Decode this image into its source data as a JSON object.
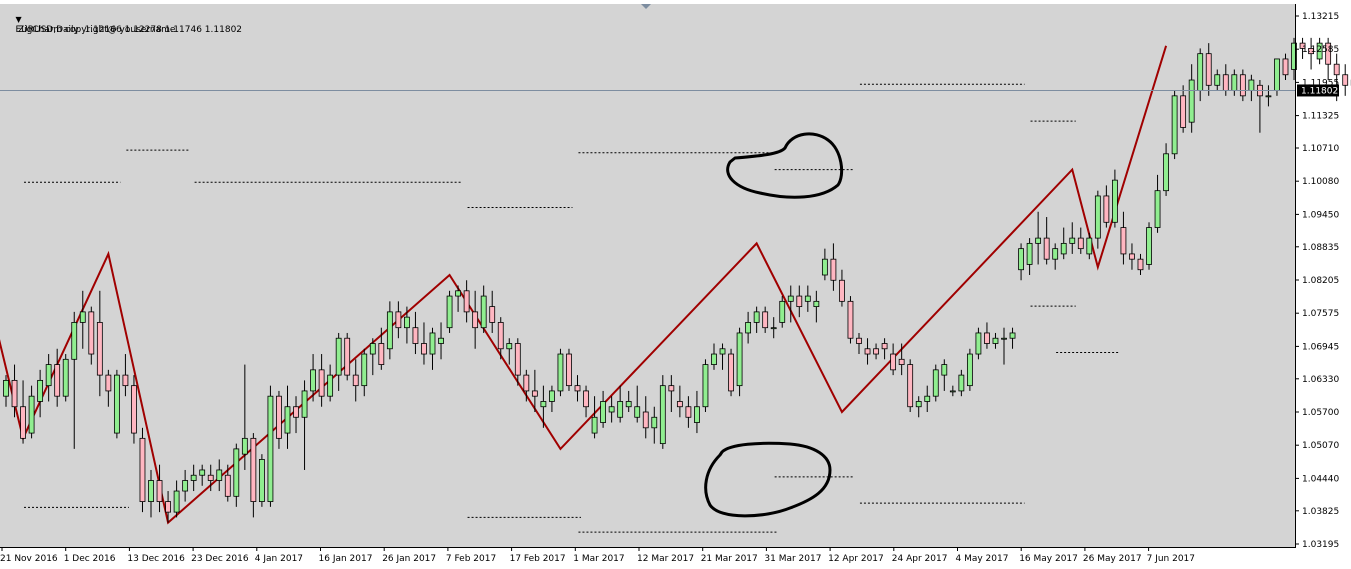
{
  "header": {
    "symbol_line": "EURUSD,Daily  1.12166 1.12278 1.11746 1.11802",
    "indicator_name": "ZigCharm copyright@ yousername"
  },
  "colors": {
    "background": "#d4d4d4",
    "bull": "#90ee90",
    "bear": "#ffb6c1",
    "wick": "#000000",
    "zigzag": "#a00000",
    "level_line": "#000000",
    "price_line": "#7d8da0",
    "price_tag": "#000000"
  },
  "price_axis": {
    "ticks": [
      "1.13215",
      "1.12585",
      "1.11955",
      "1.11325",
      "1.10710",
      "1.10080",
      "1.09450",
      "1.08835",
      "1.08205",
      "1.07575",
      "1.06945",
      "1.06330",
      "1.05700",
      "1.05070",
      "1.04440",
      "1.03825",
      "1.03195"
    ],
    "current_price": "1.11802"
  },
  "time_axis": {
    "labels": [
      "21 Nov 2016",
      "1 Dec 2016",
      "13 Dec 2016",
      "23 Dec 2016",
      "4 Jan 2017",
      "16 Jan 2017",
      "26 Jan 2017",
      "7 Feb 2017",
      "17 Feb 2017",
      "1 Mar 2017",
      "12 Mar 2017",
      "21 Mar 2017",
      "31 Mar 2017",
      "12 Apr 2017",
      "24 Apr 2017",
      "4 May 2017",
      "16 May 2017",
      "26 May 2017",
      "7 Jun 2017"
    ]
  },
  "chart_data": {
    "type": "candlestick",
    "symbol": "EURUSD",
    "timeframe": "Daily",
    "ylim": [
      1.03195,
      1.13215
    ],
    "candles": [
      {
        "o": 1.06,
        "h": 1.064,
        "l": 1.058,
        "c": 1.063
      },
      {
        "o": 1.063,
        "h": 1.066,
        "l": 1.056,
        "c": 1.058
      },
      {
        "o": 1.058,
        "h": 1.063,
        "l": 1.051,
        "c": 1.052
      },
      {
        "o": 1.053,
        "h": 1.062,
        "l": 1.052,
        "c": 1.06
      },
      {
        "o": 1.059,
        "h": 1.065,
        "l": 1.056,
        "c": 1.063
      },
      {
        "o": 1.062,
        "h": 1.068,
        "l": 1.059,
        "c": 1.066
      },
      {
        "o": 1.066,
        "h": 1.069,
        "l": 1.058,
        "c": 1.06
      },
      {
        "o": 1.06,
        "h": 1.068,
        "l": 1.059,
        "c": 1.067
      },
      {
        "o": 1.067,
        "h": 1.076,
        "l": 1.05,
        "c": 1.074
      },
      {
        "o": 1.074,
        "h": 1.08,
        "l": 1.069,
        "c": 1.076
      },
      {
        "o": 1.076,
        "h": 1.077,
        "l": 1.066,
        "c": 1.068
      },
      {
        "o": 1.074,
        "h": 1.08,
        "l": 1.06,
        "c": 1.064
      },
      {
        "o": 1.064,
        "h": 1.065,
        "l": 1.058,
        "c": 1.061
      },
      {
        "o": 1.053,
        "h": 1.065,
        "l": 1.052,
        "c": 1.064
      },
      {
        "o": 1.064,
        "h": 1.068,
        "l": 1.06,
        "c": 1.062
      },
      {
        "o": 1.062,
        "h": 1.064,
        "l": 1.051,
        "c": 1.053
      },
      {
        "o": 1.052,
        "h": 1.054,
        "l": 1.038,
        "c": 1.04
      },
      {
        "o": 1.04,
        "h": 1.046,
        "l": 1.037,
        "c": 1.044
      },
      {
        "o": 1.044,
        "h": 1.047,
        "l": 1.038,
        "c": 1.04
      },
      {
        "o": 1.04,
        "h": 1.042,
        "l": 1.036,
        "c": 1.038
      },
      {
        "o": 1.038,
        "h": 1.044,
        "l": 1.037,
        "c": 1.042
      },
      {
        "o": 1.042,
        "h": 1.046,
        "l": 1.04,
        "c": 1.044
      },
      {
        "o": 1.044,
        "h": 1.047,
        "l": 1.042,
        "c": 1.045
      },
      {
        "o": 1.045,
        "h": 1.047,
        "l": 1.043,
        "c": 1.046
      },
      {
        "o": 1.045,
        "h": 1.047,
        "l": 1.042,
        "c": 1.044
      },
      {
        "o": 1.044,
        "h": 1.048,
        "l": 1.042,
        "c": 1.046
      },
      {
        "o": 1.045,
        "h": 1.047,
        "l": 1.04,
        "c": 1.041
      },
      {
        "o": 1.041,
        "h": 1.051,
        "l": 1.039,
        "c": 1.05
      },
      {
        "o": 1.049,
        "h": 1.066,
        "l": 1.046,
        "c": 1.052
      },
      {
        "o": 1.052,
        "h": 1.053,
        "l": 1.037,
        "c": 1.04
      },
      {
        "o": 1.04,
        "h": 1.049,
        "l": 1.039,
        "c": 1.048
      },
      {
        "o": 1.04,
        "h": 1.062,
        "l": 1.039,
        "c": 1.06
      },
      {
        "o": 1.06,
        "h": 1.061,
        "l": 1.05,
        "c": 1.052
      },
      {
        "o": 1.053,
        "h": 1.062,
        "l": 1.05,
        "c": 1.058
      },
      {
        "o": 1.058,
        "h": 1.06,
        "l": 1.053,
        "c": 1.056
      },
      {
        "o": 1.056,
        "h": 1.063,
        "l": 1.046,
        "c": 1.061
      },
      {
        "o": 1.061,
        "h": 1.068,
        "l": 1.059,
        "c": 1.065
      },
      {
        "o": 1.065,
        "h": 1.068,
        "l": 1.058,
        "c": 1.06
      },
      {
        "o": 1.06,
        "h": 1.066,
        "l": 1.059,
        "c": 1.064
      },
      {
        "o": 1.064,
        "h": 1.072,
        "l": 1.061,
        "c": 1.071
      },
      {
        "o": 1.071,
        "h": 1.072,
        "l": 1.063,
        "c": 1.064
      },
      {
        "o": 1.064,
        "h": 1.067,
        "l": 1.059,
        "c": 1.062
      },
      {
        "o": 1.062,
        "h": 1.069,
        "l": 1.06,
        "c": 1.068
      },
      {
        "o": 1.068,
        "h": 1.071,
        "l": 1.064,
        "c": 1.07
      },
      {
        "o": 1.07,
        "h": 1.073,
        "l": 1.065,
        "c": 1.066
      },
      {
        "o": 1.069,
        "h": 1.078,
        "l": 1.067,
        "c": 1.076
      },
      {
        "o": 1.076,
        "h": 1.078,
        "l": 1.071,
        "c": 1.073
      },
      {
        "o": 1.073,
        "h": 1.077,
        "l": 1.07,
        "c": 1.075
      },
      {
        "o": 1.073,
        "h": 1.076,
        "l": 1.068,
        "c": 1.07
      },
      {
        "o": 1.07,
        "h": 1.074,
        "l": 1.066,
        "c": 1.068
      },
      {
        "o": 1.068,
        "h": 1.073,
        "l": 1.065,
        "c": 1.072
      },
      {
        "o": 1.07,
        "h": 1.074,
        "l": 1.067,
        "c": 1.071
      },
      {
        "o": 1.073,
        "h": 1.08,
        "l": 1.072,
        "c": 1.079
      },
      {
        "o": 1.079,
        "h": 1.081,
        "l": 1.076,
        "c": 1.08
      },
      {
        "o": 1.08,
        "h": 1.082,
        "l": 1.074,
        "c": 1.076
      },
      {
        "o": 1.076,
        "h": 1.08,
        "l": 1.069,
        "c": 1.073
      },
      {
        "o": 1.073,
        "h": 1.081,
        "l": 1.072,
        "c": 1.079
      },
      {
        "o": 1.077,
        "h": 1.08,
        "l": 1.072,
        "c": 1.074
      },
      {
        "o": 1.074,
        "h": 1.075,
        "l": 1.067,
        "c": 1.069
      },
      {
        "o": 1.069,
        "h": 1.071,
        "l": 1.066,
        "c": 1.07
      },
      {
        "o": 1.07,
        "h": 1.071,
        "l": 1.062,
        "c": 1.064
      },
      {
        "o": 1.064,
        "h": 1.065,
        "l": 1.059,
        "c": 1.061
      },
      {
        "o": 1.061,
        "h": 1.065,
        "l": 1.057,
        "c": 1.06
      },
      {
        "o": 1.058,
        "h": 1.062,
        "l": 1.054,
        "c": 1.059
      },
      {
        "o": 1.059,
        "h": 1.062,
        "l": 1.057,
        "c": 1.061
      },
      {
        "o": 1.061,
        "h": 1.069,
        "l": 1.06,
        "c": 1.068
      },
      {
        "o": 1.068,
        "h": 1.069,
        "l": 1.061,
        "c": 1.062
      },
      {
        "o": 1.062,
        "h": 1.064,
        "l": 1.059,
        "c": 1.061
      },
      {
        "o": 1.061,
        "h": 1.062,
        "l": 1.056,
        "c": 1.058
      },
      {
        "o": 1.053,
        "h": 1.06,
        "l": 1.052,
        "c": 1.056
      },
      {
        "o": 1.055,
        "h": 1.061,
        "l": 1.054,
        "c": 1.059
      },
      {
        "o": 1.057,
        "h": 1.06,
        "l": 1.055,
        "c": 1.058
      },
      {
        "o": 1.056,
        "h": 1.062,
        "l": 1.055,
        "c": 1.059
      },
      {
        "o": 1.058,
        "h": 1.061,
        "l": 1.057,
        "c": 1.059
      },
      {
        "o": 1.056,
        "h": 1.062,
        "l": 1.055,
        "c": 1.058
      },
      {
        "o": 1.057,
        "h": 1.06,
        "l": 1.052,
        "c": 1.054
      },
      {
        "o": 1.054,
        "h": 1.058,
        "l": 1.051,
        "c": 1.056
      },
      {
        "o": 1.051,
        "h": 1.064,
        "l": 1.05,
        "c": 1.062
      },
      {
        "o": 1.062,
        "h": 1.064,
        "l": 1.057,
        "c": 1.061
      },
      {
        "o": 1.059,
        "h": 1.062,
        "l": 1.056,
        "c": 1.058
      },
      {
        "o": 1.058,
        "h": 1.06,
        "l": 1.054,
        "c": 1.056
      },
      {
        "o": 1.055,
        "h": 1.061,
        "l": 1.053,
        "c": 1.058
      },
      {
        "o": 1.058,
        "h": 1.067,
        "l": 1.057,
        "c": 1.066
      },
      {
        "o": 1.066,
        "h": 1.07,
        "l": 1.065,
        "c": 1.068
      },
      {
        "o": 1.068,
        "h": 1.07,
        "l": 1.065,
        "c": 1.069
      },
      {
        "o": 1.068,
        "h": 1.069,
        "l": 1.06,
        "c": 1.061
      },
      {
        "o": 1.062,
        "h": 1.073,
        "l": 1.06,
        "c": 1.072
      },
      {
        "o": 1.072,
        "h": 1.076,
        "l": 1.07,
        "c": 1.074
      },
      {
        "o": 1.074,
        "h": 1.077,
        "l": 1.072,
        "c": 1.076
      },
      {
        "o": 1.076,
        "h": 1.077,
        "l": 1.072,
        "c": 1.073
      },
      {
        "o": 1.073,
        "h": 1.075,
        "l": 1.071,
        "c": 1.073
      },
      {
        "o": 1.074,
        "h": 1.079,
        "l": 1.073,
        "c": 1.078
      },
      {
        "o": 1.078,
        "h": 1.081,
        "l": 1.074,
        "c": 1.079
      },
      {
        "o": 1.079,
        "h": 1.081,
        "l": 1.075,
        "c": 1.077
      },
      {
        "o": 1.078,
        "h": 1.081,
        "l": 1.076,
        "c": 1.079
      },
      {
        "o": 1.077,
        "h": 1.08,
        "l": 1.074,
        "c": 1.078
      },
      {
        "o": 1.083,
        "h": 1.088,
        "l": 1.082,
        "c": 1.086
      },
      {
        "o": 1.086,
        "h": 1.089,
        "l": 1.08,
        "c": 1.082
      },
      {
        "o": 1.082,
        "h": 1.084,
        "l": 1.077,
        "c": 1.078
      },
      {
        "o": 1.078,
        "h": 1.079,
        "l": 1.07,
        "c": 1.071
      },
      {
        "o": 1.071,
        "h": 1.072,
        "l": 1.068,
        "c": 1.07
      },
      {
        "o": 1.069,
        "h": 1.071,
        "l": 1.066,
        "c": 1.068
      },
      {
        "o": 1.069,
        "h": 1.07,
        "l": 1.067,
        "c": 1.068
      },
      {
        "o": 1.07,
        "h": 1.071,
        "l": 1.067,
        "c": 1.069
      },
      {
        "o": 1.068,
        "h": 1.07,
        "l": 1.064,
        "c": 1.065
      },
      {
        "o": 1.067,
        "h": 1.07,
        "l": 1.064,
        "c": 1.066
      },
      {
        "o": 1.066,
        "h": 1.067,
        "l": 1.057,
        "c": 1.058
      },
      {
        "o": 1.058,
        "h": 1.06,
        "l": 1.056,
        "c": 1.059
      },
      {
        "o": 1.059,
        "h": 1.062,
        "l": 1.057,
        "c": 1.06
      },
      {
        "o": 1.06,
        "h": 1.066,
        "l": 1.059,
        "c": 1.065
      },
      {
        "o": 1.064,
        "h": 1.067,
        "l": 1.061,
        "c": 1.066
      },
      {
        "o": 1.061,
        "h": 1.062,
        "l": 1.06,
        "c": 1.061
      },
      {
        "o": 1.061,
        "h": 1.065,
        "l": 1.06,
        "c": 1.064
      },
      {
        "o": 1.062,
        "h": 1.069,
        "l": 1.061,
        "c": 1.068
      },
      {
        "o": 1.068,
        "h": 1.073,
        "l": 1.067,
        "c": 1.072
      },
      {
        "o": 1.072,
        "h": 1.074,
        "l": 1.069,
        "c": 1.07
      },
      {
        "o": 1.07,
        "h": 1.072,
        "l": 1.069,
        "c": 1.071
      },
      {
        "o": 1.071,
        "h": 1.073,
        "l": 1.066,
        "c": 1.071
      },
      {
        "o": 1.071,
        "h": 1.073,
        "l": 1.069,
        "c": 1.072
      },
      {
        "o": 1.084,
        "h": 1.089,
        "l": 1.082,
        "c": 1.088
      },
      {
        "o": 1.085,
        "h": 1.09,
        "l": 1.083,
        "c": 1.089
      },
      {
        "o": 1.089,
        "h": 1.095,
        "l": 1.085,
        "c": 1.09
      },
      {
        "o": 1.09,
        "h": 1.094,
        "l": 1.085,
        "c": 1.086
      },
      {
        "o": 1.086,
        "h": 1.089,
        "l": 1.084,
        "c": 1.088
      },
      {
        "o": 1.087,
        "h": 1.092,
        "l": 1.086,
        "c": 1.089
      },
      {
        "o": 1.089,
        "h": 1.093,
        "l": 1.087,
        "c": 1.09
      },
      {
        "o": 1.09,
        "h": 1.092,
        "l": 1.087,
        "c": 1.088
      },
      {
        "o": 1.087,
        "h": 1.091,
        "l": 1.086,
        "c": 1.09
      },
      {
        "o": 1.09,
        "h": 1.099,
        "l": 1.088,
        "c": 1.098
      },
      {
        "o": 1.098,
        "h": 1.1,
        "l": 1.092,
        "c": 1.093
      },
      {
        "o": 1.093,
        "h": 1.103,
        "l": 1.092,
        "c": 1.101
      },
      {
        "o": 1.092,
        "h": 1.095,
        "l": 1.085,
        "c": 1.087
      },
      {
        "o": 1.087,
        "h": 1.089,
        "l": 1.084,
        "c": 1.086
      },
      {
        "o": 1.086,
        "h": 1.087,
        "l": 1.083,
        "c": 1.084
      },
      {
        "o": 1.085,
        "h": 1.093,
        "l": 1.084,
        "c": 1.092
      },
      {
        "o": 1.092,
        "h": 1.102,
        "l": 1.091,
        "c": 1.099
      },
      {
        "o": 1.099,
        "h": 1.108,
        "l": 1.098,
        "c": 1.106
      },
      {
        "o": 1.106,
        "h": 1.118,
        "l": 1.105,
        "c": 1.117
      },
      {
        "o": 1.117,
        "h": 1.119,
        "l": 1.11,
        "c": 1.111
      },
      {
        "o": 1.112,
        "h": 1.123,
        "l": 1.11,
        "c": 1.12
      },
      {
        "o": 1.118,
        "h": 1.126,
        "l": 1.116,
        "c": 1.125
      },
      {
        "o": 1.125,
        "h": 1.127,
        "l": 1.117,
        "c": 1.119
      },
      {
        "o": 1.119,
        "h": 1.122,
        "l": 1.118,
        "c": 1.121
      },
      {
        "o": 1.121,
        "h": 1.123,
        "l": 1.117,
        "c": 1.118
      },
      {
        "o": 1.118,
        "h": 1.122,
        "l": 1.117,
        "c": 1.121
      },
      {
        "o": 1.121,
        "h": 1.122,
        "l": 1.116,
        "c": 1.117
      },
      {
        "o": 1.118,
        "h": 1.121,
        "l": 1.116,
        "c": 1.12
      },
      {
        "o": 1.119,
        "h": 1.12,
        "l": 1.11,
        "c": 1.117
      },
      {
        "o": 1.117,
        "h": 1.119,
        "l": 1.115,
        "c": 1.117
      },
      {
        "o": 1.118,
        "h": 1.124,
        "l": 1.117,
        "c": 1.124
      },
      {
        "o": 1.124,
        "h": 1.125,
        "l": 1.12,
        "c": 1.121
      },
      {
        "o": 1.122,
        "h": 1.128,
        "l": 1.12,
        "c": 1.127
      },
      {
        "o": 1.127,
        "h": 1.128,
        "l": 1.124,
        "c": 1.126
      },
      {
        "o": 1.126,
        "h": 1.128,
        "l": 1.122,
        "c": 1.125
      },
      {
        "o": 1.124,
        "h": 1.128,
        "l": 1.123,
        "c": 1.127
      },
      {
        "o": 1.127,
        "h": 1.128,
        "l": 1.12,
        "c": 1.123
      },
      {
        "o": 1.123,
        "h": 1.125,
        "l": 1.116,
        "c": 1.121
      },
      {
        "o": 1.121,
        "h": 1.123,
        "l": 1.117,
        "c": 1.119
      },
      {
        "o": 1.119,
        "h": 1.122,
        "l": 1.118,
        "c": 1.12
      },
      {
        "o": 1.119,
        "h": 1.123,
        "l": 1.118,
        "c": 1.12
      },
      {
        "o": 1.12,
        "h": 1.13,
        "l": 1.119,
        "c": 1.121
      },
      {
        "o": 1.1217,
        "h": 1.1228,
        "l": 1.1175,
        "c": 1.118
      }
    ],
    "zigzag": [
      {
        "bar": -1,
        "price": 1.072
      },
      {
        "bar": 2,
        "price": 1.052
      },
      {
        "bar": 12,
        "price": 1.087
      },
      {
        "bar": 19,
        "price": 1.036
      },
      {
        "bar": 52,
        "price": 1.083
      },
      {
        "bar": 65,
        "price": 1.05
      },
      {
        "bar": 88,
        "price": 1.089
      },
      {
        "bar": 98,
        "price": 1.057
      },
      {
        "bar": 125,
        "price": 1.103
      },
      {
        "bar": 128,
        "price": 1.0845
      },
      {
        "bar": 136,
        "price": 1.1265
      }
    ],
    "level_lines": [
      {
        "from_bar": 0,
        "to_bar": 12,
        "price": 1.1006
      },
      {
        "from_bar": 12,
        "to_bar": 20,
        "price": 1.1067
      },
      {
        "from_bar": 20,
        "to_bar": 52,
        "price": 1.1006
      },
      {
        "from_bar": 52,
        "to_bar": 65,
        "price": 1.0958
      },
      {
        "from_bar": 65,
        "to_bar": 88,
        "price": 1.1062
      },
      {
        "from_bar": 88,
        "to_bar": 98,
        "price": 1.103
      },
      {
        "from_bar": 98,
        "to_bar": 118,
        "price": 1.1192
      },
      {
        "from_bar": 118,
        "to_bar": 124,
        "price": 1.1122
      },
      {
        "from_bar": 0,
        "to_bar": 13,
        "price": 1.0389
      },
      {
        "from_bar": 52,
        "to_bar": 66,
        "price": 1.037
      },
      {
        "from_bar": 65,
        "to_bar": 89,
        "price": 1.0342
      },
      {
        "from_bar": 88,
        "to_bar": 98,
        "price": 1.0447
      },
      {
        "from_bar": 98,
        "to_bar": 118,
        "price": 1.0397
      },
      {
        "from_bar": 118,
        "to_bar": 124,
        "price": 1.0771
      },
      {
        "from_bar": 121,
        "to_bar": 129,
        "price": 1.0683
      }
    ]
  }
}
